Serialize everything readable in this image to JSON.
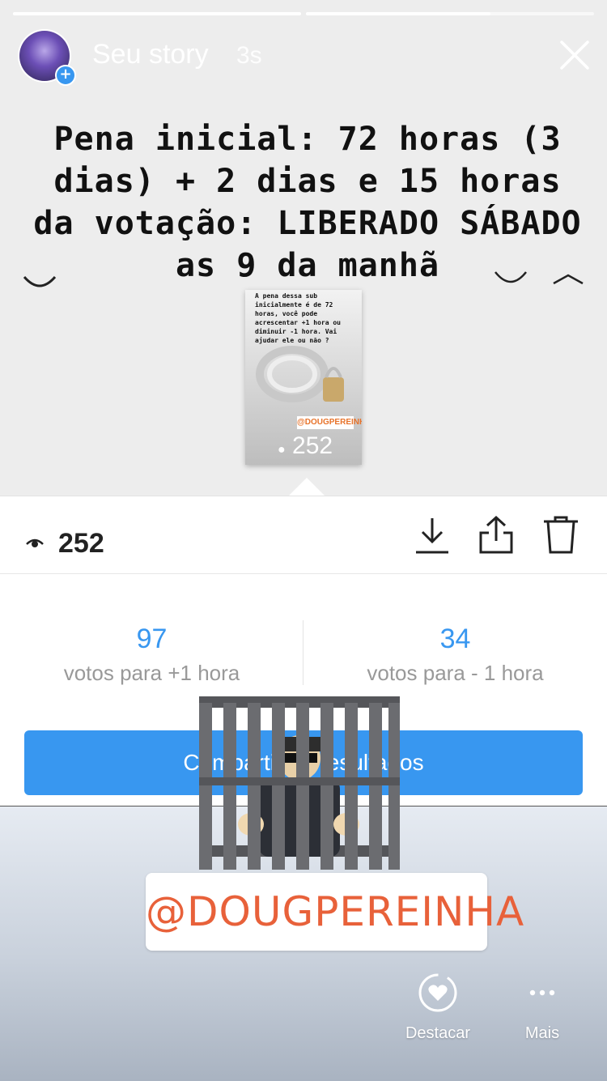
{
  "story": {
    "progress": [
      1.0,
      0.64
    ],
    "header": {
      "title": "Seu story",
      "time": "3s"
    },
    "text": "Pena inicial: 72 horas (3 dias) + 2 dias e 15 horas da votação: LIBERADO SÁBADO as 9 da manhã",
    "thumbnail": {
      "text": "A pena dessa sub inicialmente é de 72 horas, você pode acrescentar +1 hora ou diminuir -1 hora. Vai ajudar ele ou não ?",
      "handle": "@DOUGPEREINHA",
      "views": "252"
    }
  },
  "viewer": {
    "views": "252",
    "icons": [
      "eye-icon",
      "download-icon",
      "share-icon",
      "trash-icon"
    ]
  },
  "poll": {
    "left": {
      "count": "97",
      "label": "votos para +1 hora"
    },
    "right": {
      "count": "34",
      "label": "votos para - 1 hora"
    },
    "share_button": "Compartilhar resultados"
  },
  "stickers": {
    "handle": "@DOUGPEREINHA"
  },
  "footer": {
    "highlight": {
      "label": "Destacar",
      "icon": "heart-circle-icon"
    },
    "more": {
      "label": "Mais",
      "icon": "more-dots-icon"
    }
  },
  "colors": {
    "accent": "#3897f0",
    "handle": "#e8613a"
  }
}
